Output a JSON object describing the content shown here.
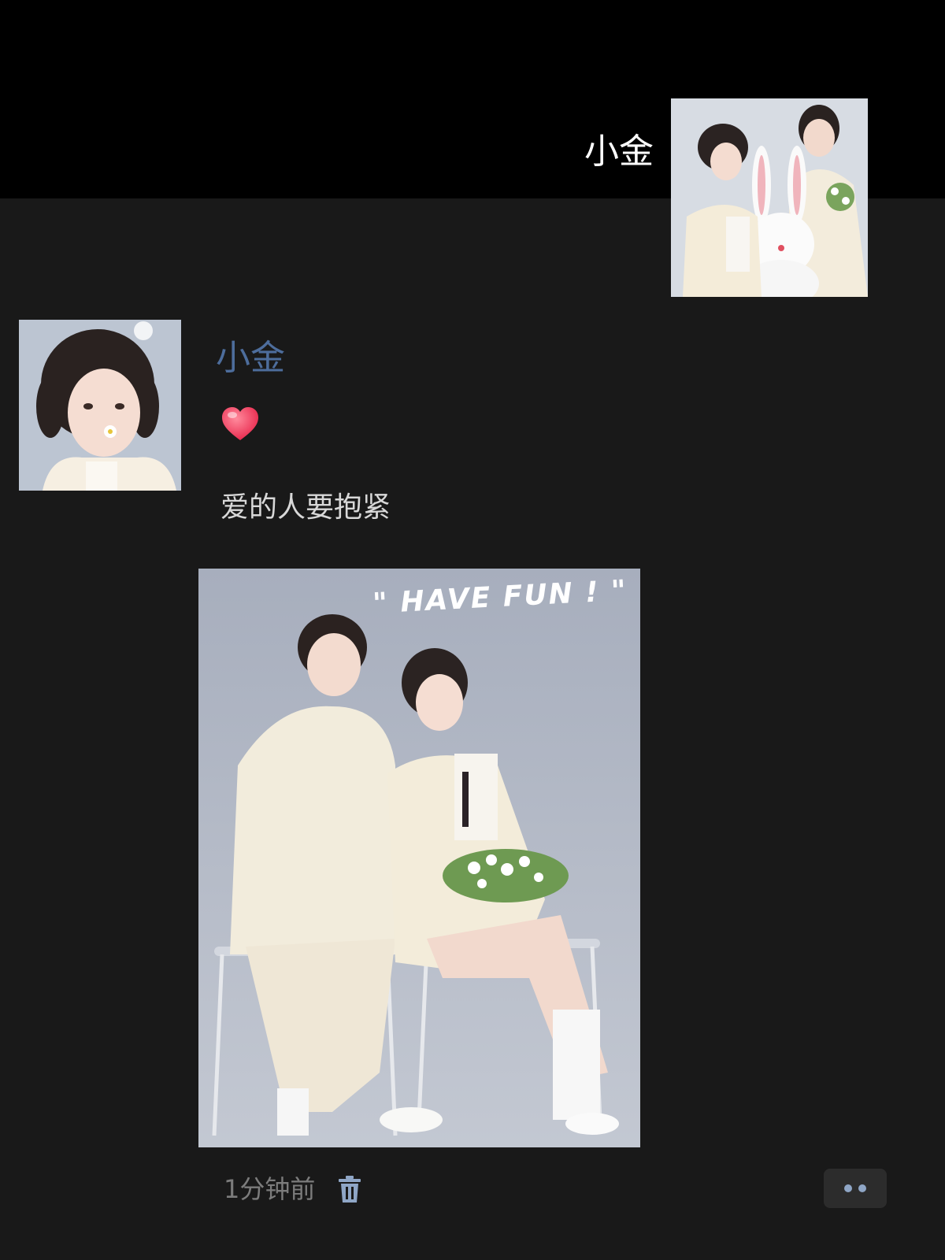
{
  "header": {
    "name": "小金"
  },
  "post": {
    "author": "小金",
    "emoji": "heart",
    "caption": "爱的人要抱紧",
    "photo_text": "\" HAVE FUN ! \"",
    "timestamp": "1分钟前"
  },
  "colors": {
    "background": "#191919",
    "header_background": "#000000",
    "author_name": "#4d6d9c",
    "caption": "#d8d8d8",
    "timestamp": "#7c7c7c"
  },
  "icons": [
    "heart-emoji",
    "delete-icon",
    "more-icon"
  ]
}
